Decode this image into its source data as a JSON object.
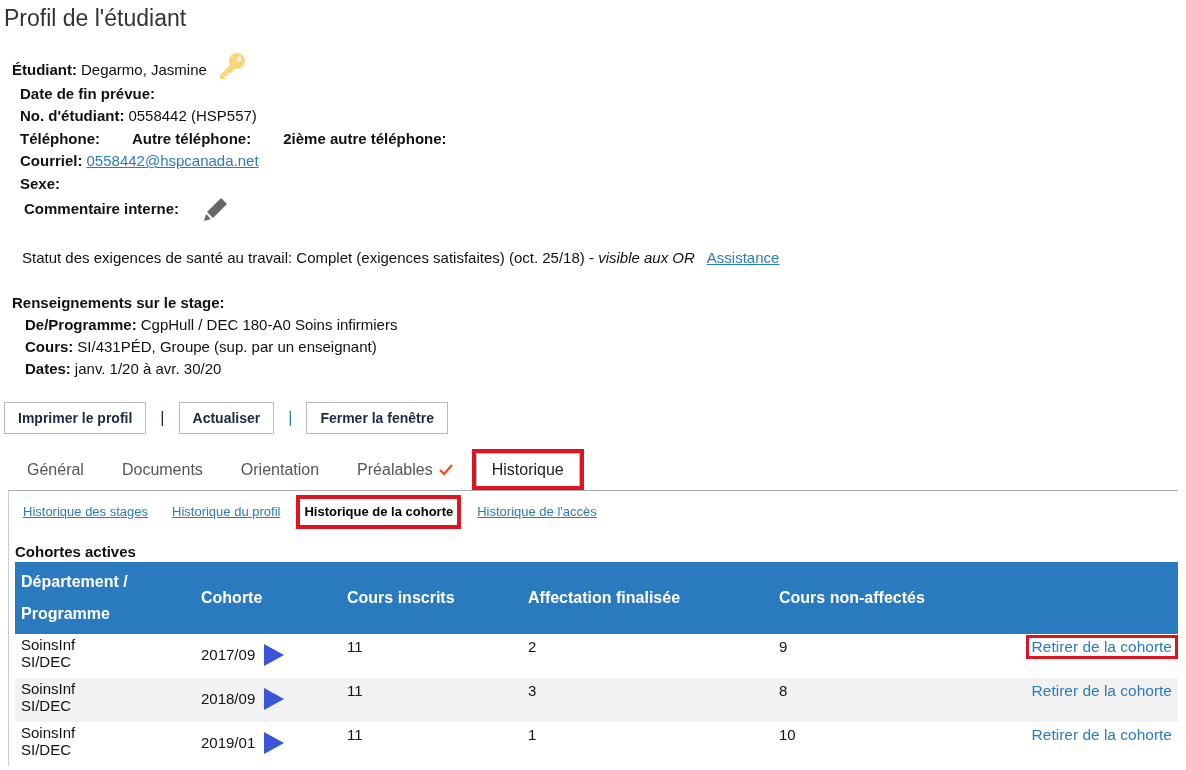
{
  "page_title": "Profil de l'étudiant",
  "fields": [
    {
      "kind": "student",
      "label": "Étudiant:",
      "value": "Degarmo, Jasmine"
    },
    {
      "kind": "text",
      "label": "Date de fin prévue:"
    },
    {
      "kind": "text",
      "label": "No. d'étudiant:",
      "value": "0558442  (HSP557)"
    },
    {
      "kind": "phones",
      "labels": [
        "Téléphone:",
        "Autre téléphone:",
        "2ième autre téléphone:"
      ]
    },
    {
      "kind": "email",
      "label": "Courriel:",
      "value": "0558442@hspcanada.net"
    },
    {
      "kind": "text",
      "label": "Sexe:"
    },
    {
      "kind": "comment",
      "label": "Commentaire interne:"
    }
  ],
  "health_status": {
    "text": "Statut des exigences de santé au travail: Complet (exigences satisfaites) (oct. 25/18) - *visible aux OR*",
    "link": "Assistance"
  },
  "placement": {
    "title": "Renseignements sur le stage:",
    "rows": [
      {
        "label": "De/Programme:",
        "value": "CgpHull / DEC 180-A0 Soins infirmiers"
      },
      {
        "label": "Cours:",
        "value": "SI/431PÉD, Groupe (sup. par un enseignant)"
      },
      {
        "label": "Dates:",
        "value": "janv. 1/20  à  avr. 30/20"
      }
    ]
  },
  "toolbar": [
    {
      "kind": "button",
      "label": "Imprimer le profil"
    },
    {
      "kind": "separator",
      "label": "|",
      "color": "#1a1a5e"
    },
    {
      "kind": "button",
      "label": "Actualiser"
    },
    {
      "kind": "separator",
      "label": "|",
      "color": "#2a7abf"
    },
    {
      "kind": "button",
      "label": "Fermer la fenêtre"
    }
  ],
  "tabs": [
    {
      "label": "Général",
      "selected": false,
      "checked": false,
      "highlighted": false
    },
    {
      "label": "Documents",
      "selected": false,
      "checked": false,
      "highlighted": false
    },
    {
      "label": "Orientation",
      "selected": false,
      "checked": false,
      "highlighted": false
    },
    {
      "label": "Préalables",
      "selected": false,
      "checked": true,
      "highlighted": false
    },
    {
      "label": "Historique",
      "selected": true,
      "checked": false,
      "highlighted": true
    }
  ],
  "subtabs": [
    {
      "label": "Historique des stages",
      "selected": false,
      "highlighted": false
    },
    {
      "label": "Historique du profil",
      "selected": false,
      "highlighted": false
    },
    {
      "label": "Historique de la cohorte",
      "selected": true,
      "highlighted": true
    },
    {
      "label": "Historique de l'accès",
      "selected": false,
      "highlighted": false
    }
  ],
  "table": {
    "title": "Cohortes actives",
    "columns": [
      "Département / Programme",
      "Cohorte",
      "Cours inscrits",
      "Affectation finalisée",
      "Cours non-affectés"
    ],
    "rows": [
      {
        "department": "SoinsInf",
        "program": "SI/DEC",
        "cohort": "2017/09",
        "enrolled": "11",
        "finalized": "2",
        "unassigned": "9",
        "action": "Retirer de la cohorte",
        "highlighted": true
      },
      {
        "department": "SoinsInf",
        "program": "SI/DEC",
        "cohort": "2018/09",
        "enrolled": "11",
        "finalized": "3",
        "unassigned": "8",
        "action": "Retirer de la cohorte",
        "highlighted": false
      },
      {
        "department": "SoinsInf",
        "program": "SI/DEC",
        "cohort": "2019/01",
        "enrolled": "11",
        "finalized": "1",
        "unassigned": "10",
        "action": "Retirer de la cohorte",
        "highlighted": false
      }
    ]
  }
}
